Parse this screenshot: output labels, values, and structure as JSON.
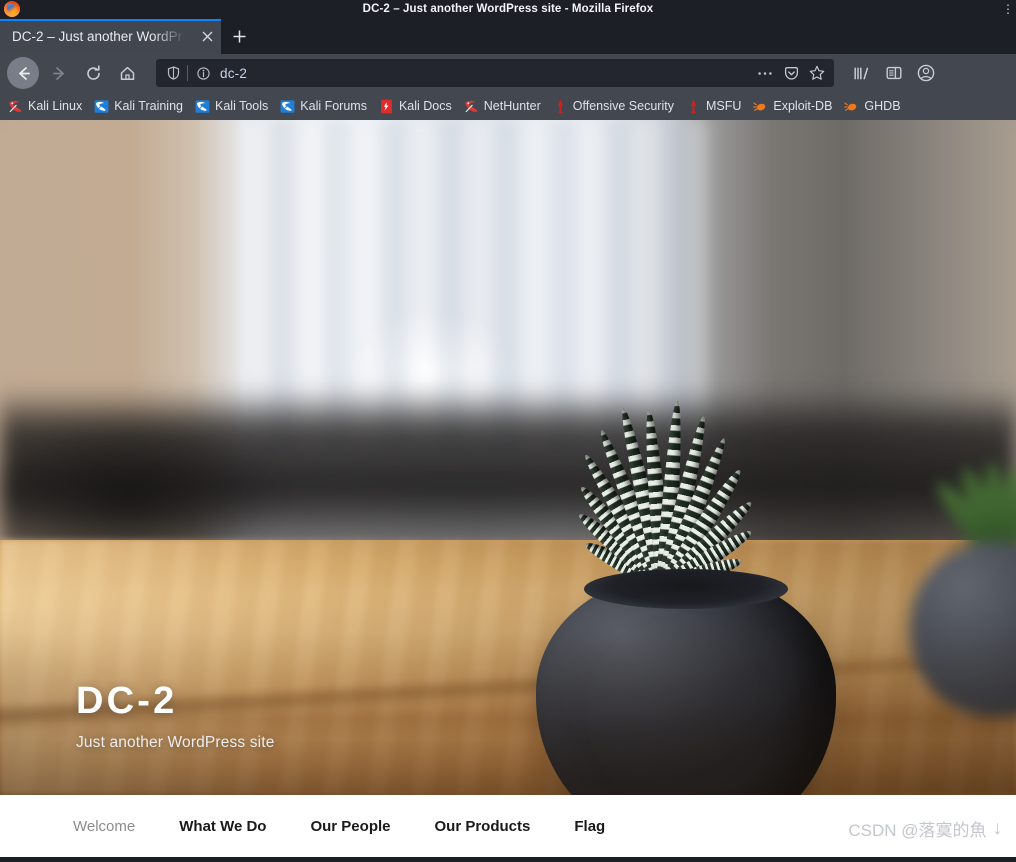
{
  "window": {
    "title": "DC-2 – Just another WordPress site - Mozilla Firefox",
    "app_icon": "firefox-logo",
    "overflow": "⋮"
  },
  "tabbar": {
    "tabs": [
      {
        "title": "DC-2 – Just another WordPr",
        "close_icon": "close-icon",
        "active": true
      }
    ],
    "new_tab_label": "+"
  },
  "toolbar": {
    "back_icon": "back-arrow-icon",
    "forward_icon": "forward-arrow-icon",
    "reload_icon": "reload-icon",
    "home_icon": "home-icon",
    "urlbar": {
      "shield_icon": "shield-icon",
      "info_icon": "info-circle-icon",
      "value": "dc-2",
      "placeholder": "Search or enter address",
      "page_actions_icon": "ellipsis-icon",
      "pocket_icon": "pocket-icon",
      "bookmark_icon": "star-icon"
    },
    "library_icon": "library-icon",
    "sidebar_icon": "sidebar-icon",
    "account_icon": "account-icon"
  },
  "bookmarks": [
    {
      "label": "Kali Linux",
      "icon": "kali-dragon-red-icon",
      "color": "#d93a3a"
    },
    {
      "label": "Kali Training",
      "icon": "kali-dragon-blue-icon",
      "color": "#1f7fd6"
    },
    {
      "label": "Kali Tools",
      "icon": "kali-dragon-blue-icon",
      "color": "#1f7fd6"
    },
    {
      "label": "Kali Forums",
      "icon": "kali-dragon-blue-icon",
      "color": "#1f7fd6"
    },
    {
      "label": "Kali Docs",
      "icon": "kali-docs-icon",
      "color": "#e02b2b"
    },
    {
      "label": "NetHunter",
      "icon": "kali-dragon-red-icon",
      "color": "#d93a3a"
    },
    {
      "label": "Offensive Security",
      "icon": "offsec-torch-icon",
      "color": "#cc2222"
    },
    {
      "label": "MSFU",
      "icon": "offsec-torch-icon",
      "color": "#cc2222"
    },
    {
      "label": "Exploit-DB",
      "icon": "exploitdb-icon",
      "color": "#f07818"
    },
    {
      "label": "GHDB",
      "icon": "exploitdb-icon",
      "color": "#f07818"
    }
  ],
  "site": {
    "title": "DC-2",
    "tagline": "Just another WordPress site",
    "hero_image_alt": "zebra-haworthia-succulent-in-dark-pot-on-wooden-table",
    "nav": [
      {
        "label": "Welcome",
        "current": true
      },
      {
        "label": "What We Do",
        "current": false
      },
      {
        "label": "Our People",
        "current": false
      },
      {
        "label": "Our Products",
        "current": false
      },
      {
        "label": "Flag",
        "current": false
      }
    ]
  },
  "watermark": {
    "text": "CSDN @落寞的魚",
    "arrow": "↓"
  }
}
